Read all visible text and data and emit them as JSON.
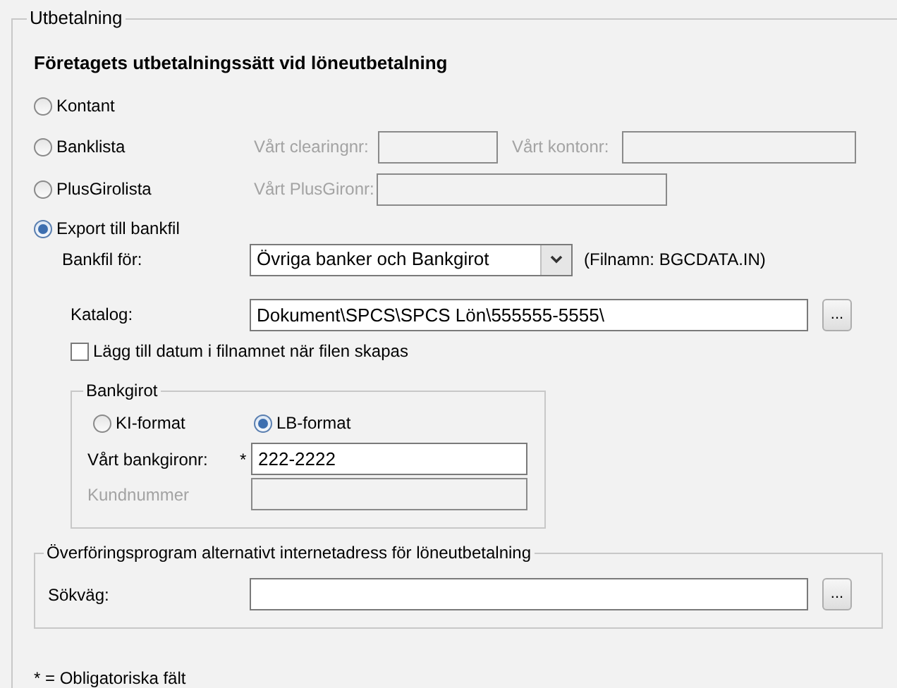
{
  "group_title": "Utbetalning",
  "heading": "Företagets utbetalningssätt vid löneutbetalning",
  "payment_methods": [
    {
      "label": "Kontant",
      "selected": false
    },
    {
      "label": "Banklista",
      "selected": false,
      "fields": [
        {
          "label": "Vårt clearingnr:",
          "disabled": true
        },
        {
          "label": "Vårt kontonr:",
          "disabled": true
        }
      ]
    },
    {
      "label": "PlusGirolista",
      "selected": false,
      "fields": [
        {
          "label": "Vårt PlusGironr:",
          "disabled": true
        }
      ]
    },
    {
      "label": "Export till bankfil",
      "selected": true
    }
  ],
  "bank_file": {
    "label": "Bankfil för:",
    "value": "Övriga banker och Bankgirot",
    "note": "(Filnamn: BGCDATA.IN)"
  },
  "catalog": {
    "label": "Katalog:",
    "value": "Dokument\\SPCS\\SPCS Lön\\555555-5555\\",
    "button": "..."
  },
  "add_date": {
    "label": "Lägg till datum i filnamnet när filen skapas",
    "checked": false
  },
  "bankgirot": {
    "title": "Bankgirot",
    "formats": [
      {
        "label": "KI-format",
        "selected": false
      },
      {
        "label": "LB-format",
        "selected": true
      }
    ],
    "fields": [
      {
        "label": "Vårt bankgironr:",
        "required_mark": "*",
        "value": "222-2222",
        "disabled": false
      },
      {
        "label": "Kundnummer",
        "disabled": true
      }
    ]
  },
  "transfer": {
    "title": "Överföringsprogram alternativt internetadress för löneutbetalning",
    "label": "Sökväg:",
    "button": "..."
  },
  "footnote": "* = Obligatoriska fält"
}
